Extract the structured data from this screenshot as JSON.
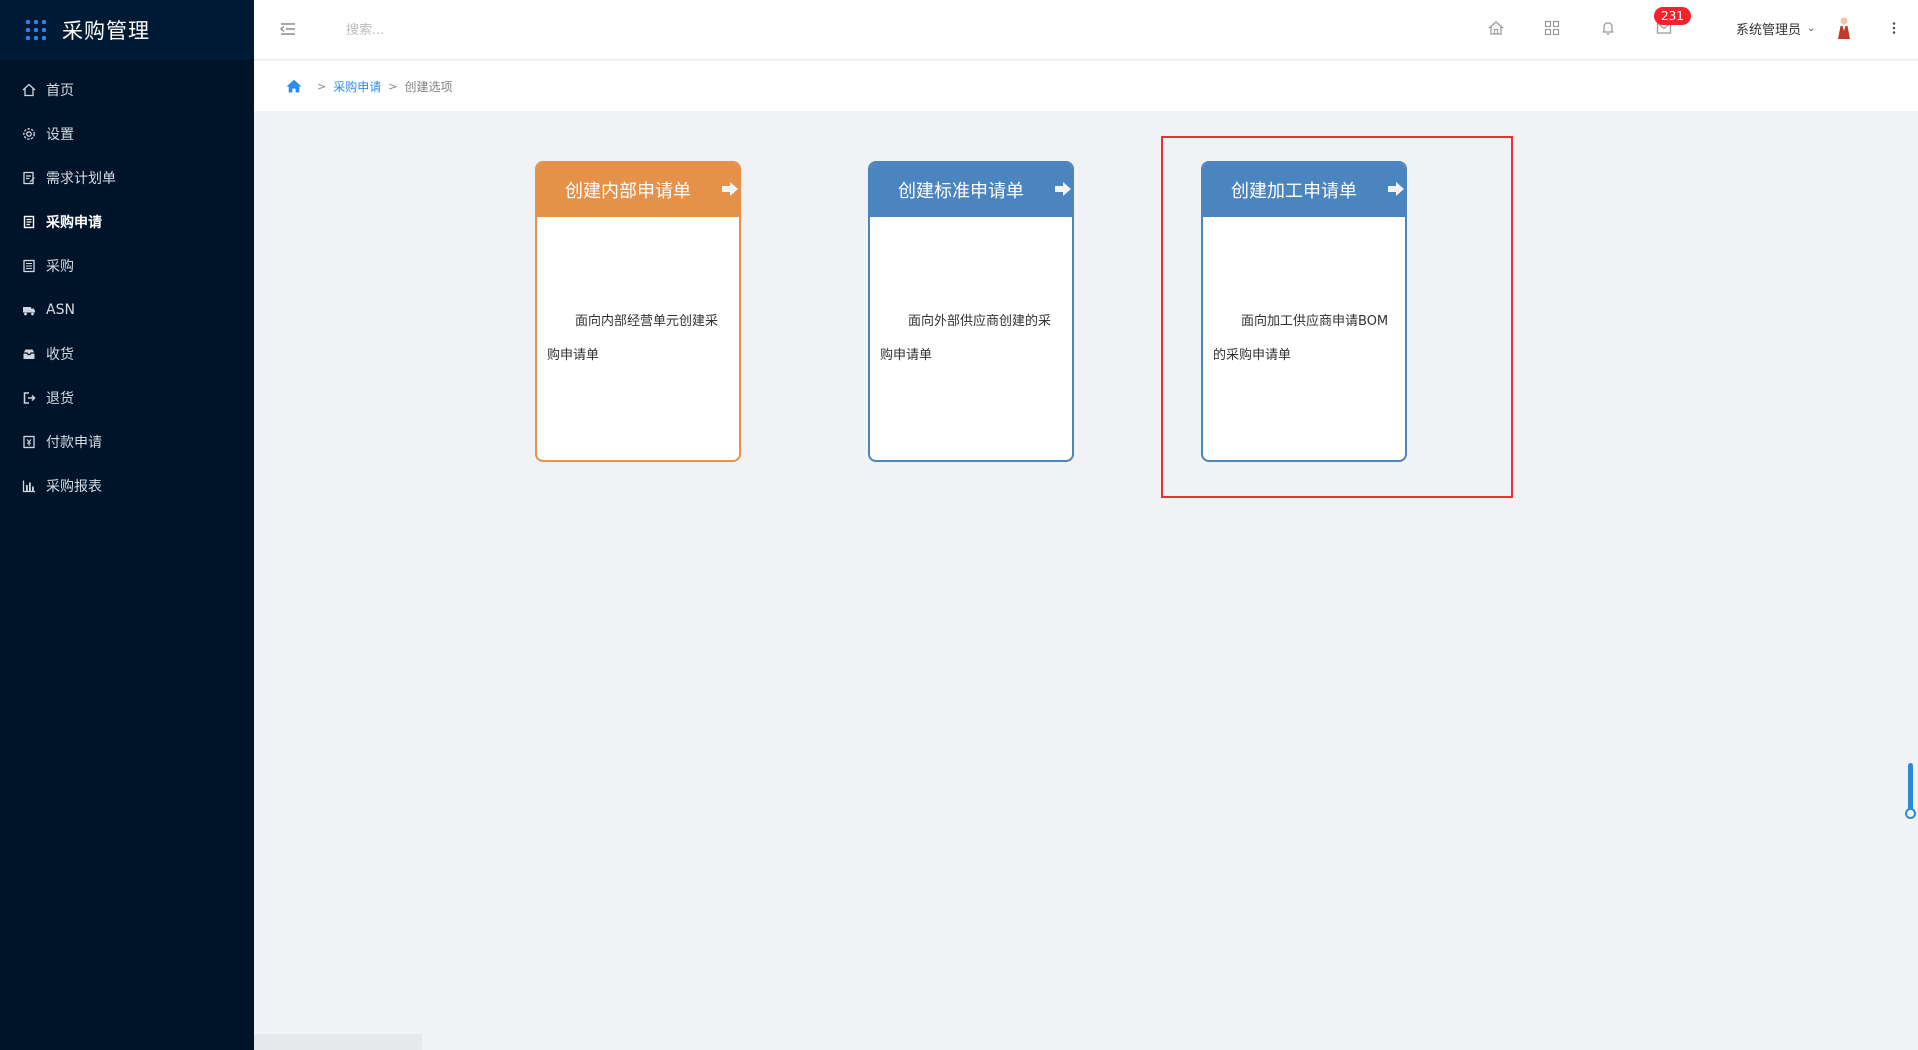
{
  "app": {
    "title": "采购管理"
  },
  "sidebar": {
    "items": [
      {
        "label": "首页",
        "icon": "home-icon",
        "active": false
      },
      {
        "label": "设置",
        "icon": "gear-icon",
        "active": false
      },
      {
        "label": "需求计划单",
        "icon": "edit-doc-icon",
        "active": false
      },
      {
        "label": "采购申请",
        "icon": "document-icon",
        "active": true
      },
      {
        "label": "采购",
        "icon": "list-doc-icon",
        "active": false
      },
      {
        "label": "ASN",
        "icon": "truck-icon",
        "active": false
      },
      {
        "label": "收货",
        "icon": "inbox-icon",
        "active": false
      },
      {
        "label": "退货",
        "icon": "logout-icon",
        "active": false
      },
      {
        "label": "付款申请",
        "icon": "payment-icon",
        "active": false
      },
      {
        "label": "采购报表",
        "icon": "bar-chart-icon",
        "active": false
      }
    ]
  },
  "header": {
    "search_placeholder": "搜索...",
    "notification_count": "231",
    "user_name": "系统管理员"
  },
  "breadcrumb": {
    "items": [
      "采购申请",
      "创建选项"
    ]
  },
  "cards": [
    {
      "title": "创建内部申请单",
      "description": "面向内部经营单元创建采购申请单",
      "color": "#e5914a"
    },
    {
      "title": "创建标准申请单",
      "description": "面向外部供应商创建的采购申请单",
      "color": "#4a85bf"
    },
    {
      "title": "创建加工申请单",
      "description": "面向加工供应商申请BOM的采购申请单",
      "color": "#4a85bf"
    }
  ],
  "colors": {
    "sidebar_bg": "#001429",
    "accent": "#2d8cf0",
    "highlight": "#ea3232",
    "badge": "#f5222d"
  }
}
